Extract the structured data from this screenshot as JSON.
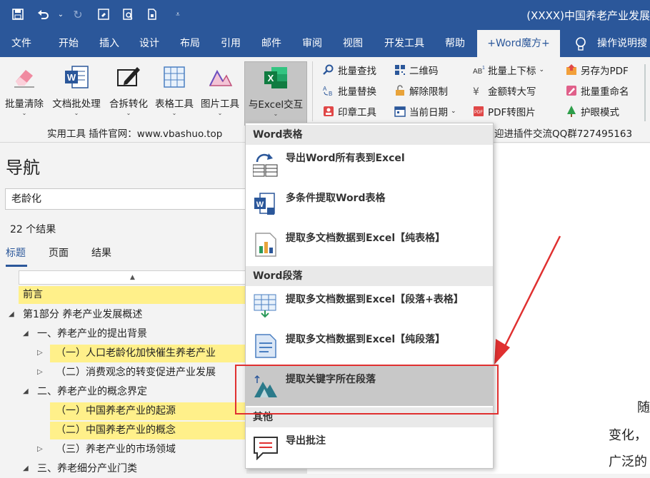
{
  "window": {
    "title": "(XXXX)中国养老产业发展",
    "quick_access": [
      "save-icon",
      "undo-icon",
      "redo-icon",
      "save-as-icon",
      "print-preview-icon",
      "new-doc-icon",
      "customize-icon"
    ]
  },
  "tabs": [
    {
      "label": "文件"
    },
    {
      "label": "开始"
    },
    {
      "label": "插入"
    },
    {
      "label": "设计"
    },
    {
      "label": "布局"
    },
    {
      "label": "引用"
    },
    {
      "label": "邮件"
    },
    {
      "label": "审阅"
    },
    {
      "label": "视图"
    },
    {
      "label": "开发工具"
    },
    {
      "label": "帮助"
    },
    {
      "label": "+Word魔方+"
    },
    {
      "label": "操作说明搜"
    }
  ],
  "ribbon": {
    "big_buttons": [
      {
        "label": "批量清除",
        "icon": "eraser-icon"
      },
      {
        "label": "文档批处理",
        "icon": "word-doc-icon"
      },
      {
        "label": "合拆转化",
        "icon": "edit-icon"
      },
      {
        "label": "表格工具",
        "icon": "table-icon"
      },
      {
        "label": "图片工具",
        "icon": "image-icon"
      },
      {
        "label": "与Excel交互",
        "icon": "excel-icon"
      }
    ],
    "small_buttons": [
      {
        "label": "批量查找",
        "icon": "search-icon"
      },
      {
        "label": "二维码",
        "icon": "qrcode-icon"
      },
      {
        "label": "批量上下标",
        "icon": "superscript-icon"
      },
      {
        "label": "另存为PDF",
        "icon": "pdf-save-icon"
      },
      {
        "label": "批量替换",
        "icon": "replace-icon"
      },
      {
        "label": "解除限制",
        "icon": "unlock-icon"
      },
      {
        "label": "金额转大写",
        "icon": "money-icon"
      },
      {
        "label": "批量重命名",
        "icon": "rename-icon"
      },
      {
        "label": "印章工具",
        "icon": "stamp-icon"
      },
      {
        "label": "当前日期",
        "icon": "calendar-icon"
      },
      {
        "label": "PDF转图片",
        "icon": "pdf-image-icon"
      },
      {
        "label": "护眼模式",
        "icon": "tree-icon"
      }
    ],
    "group_label": "实用工具  插件官网：www.vbashuo.top",
    "group_label_right": "迎进插件交流QQ群727495163"
  },
  "nav": {
    "title": "导航",
    "search_value": "老龄化",
    "result_count": "22 个结果",
    "tabs": [
      "标题",
      "页面",
      "结果"
    ],
    "headings": [
      {
        "text": "前言",
        "highlight": true
      },
      {
        "text": "第1部分  养老产业发展概述",
        "highlight": false
      },
      {
        "text": "一、养老产业的提出背景",
        "highlight": false
      },
      {
        "text": "（一）人口老龄化加快催生养老产业",
        "highlight": true
      },
      {
        "text": "（二）消费观念的转变促进产业发展",
        "highlight": false
      },
      {
        "text": "二、养老产业的概念界定",
        "highlight": false
      },
      {
        "text": "（一）中国养老产业的起源",
        "highlight": true
      },
      {
        "text": "（二）中国养老产业的概念",
        "highlight": true
      },
      {
        "text": "（三）养老产业的市场领域",
        "highlight": false
      },
      {
        "text": "三、养老细分产业门类",
        "highlight": false
      }
    ]
  },
  "menu": {
    "sections": [
      {
        "header": "Word表格",
        "items": [
          {
            "label": "导出Word所有表到Excel",
            "icon": "export-table-icon"
          },
          {
            "label": "多条件提取Word表格",
            "icon": "word-extract-icon"
          },
          {
            "label": "提取多文档数据到Excel【纯表格】",
            "icon": "chart-doc-icon"
          }
        ]
      },
      {
        "header": "Word段落",
        "items": [
          {
            "label": "提取多文档数据到Excel【段落+表格】",
            "icon": "grid-extract-icon"
          },
          {
            "label": "提取多文档数据到Excel【纯段落】",
            "icon": "paragraph-doc-icon"
          },
          {
            "label": "提取关键字所在段落",
            "icon": "mountain-icon"
          }
        ]
      },
      {
        "header": "其他",
        "items": [
          {
            "label": "导出批注",
            "icon": "comment-icon"
          }
        ]
      }
    ]
  },
  "document": {
    "lines": [
      "随",
      "变化，",
      "广泛的"
    ]
  },
  "colors": {
    "accent": "#2b579a",
    "highlight": "#fff08a",
    "annotation": "#e03030"
  }
}
